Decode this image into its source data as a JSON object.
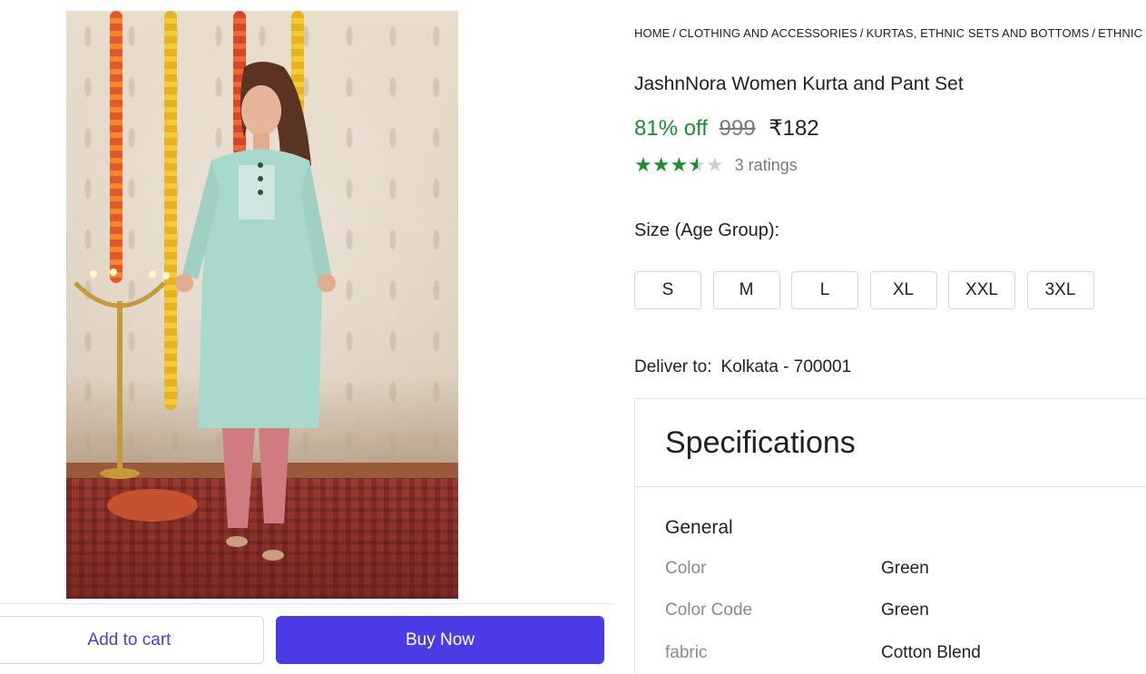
{
  "product": {
    "breadcrumb": [
      "HOME",
      "CLOTHING AND ACCESSORIES",
      "KURTAS, ETHNIC SETS AND BOTTOMS",
      "ETHNIC"
    ],
    "title": "JashnNora Women Kurta and Pant Set",
    "discount": "81% off",
    "mrp": "999",
    "price": "₹182",
    "rating": 3.5,
    "ratings_count": "3 ratings"
  },
  "size": {
    "label": "Size (Age Group):",
    "options": [
      "S",
      "M",
      "L",
      "XL",
      "XXL",
      "3XL"
    ]
  },
  "delivery": {
    "label": "Deliver to:",
    "location": "Kolkata - 700001"
  },
  "specifications": {
    "heading": "Specifications",
    "group": "General",
    "rows": [
      {
        "key": "Color",
        "value": "Green"
      },
      {
        "key": "Color Code",
        "value": "Green"
      },
      {
        "key": "fabric",
        "value": "Cotton Blend"
      }
    ]
  },
  "actions": {
    "add_to_cart": "Add to cart",
    "buy_now": "Buy Now"
  },
  "colors": {
    "accent": "#4b3be4",
    "discount": "#1b8f2e",
    "star": "#1b8f2e"
  }
}
